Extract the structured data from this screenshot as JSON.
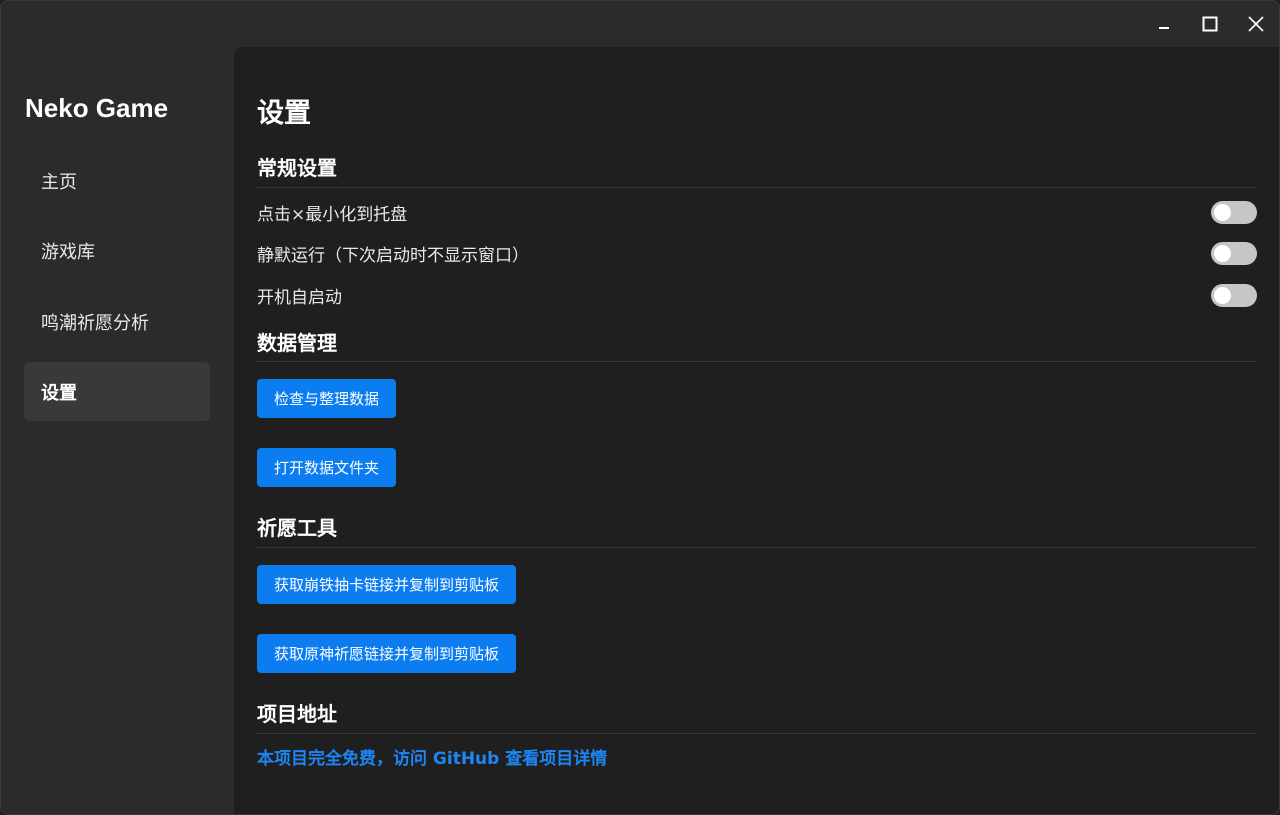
{
  "window": {
    "controls": {
      "minimize_icon": "minimize-icon",
      "maximize_icon": "maximize-icon",
      "close_icon": "close-icon"
    }
  },
  "sidebar": {
    "app_title": "Neko Game",
    "items": [
      {
        "label": "主页",
        "active": false
      },
      {
        "label": "游戏库",
        "active": false
      },
      {
        "label": "鸣潮祈愿分析",
        "active": false
      },
      {
        "label": "设置",
        "active": true
      }
    ]
  },
  "main": {
    "page_title": "设置",
    "general": {
      "title": "常规设置",
      "settings": [
        {
          "label": "点击×最小化到托盘",
          "enabled": false
        },
        {
          "label": "静默运行（下次启动时不显示窗口）",
          "enabled": false
        },
        {
          "label": "开机自启动",
          "enabled": false
        }
      ]
    },
    "data_management": {
      "title": "数据管理",
      "buttons": [
        "检查与整理数据",
        "打开数据文件夹"
      ]
    },
    "wish_tools": {
      "title": "祈愿工具",
      "buttons": [
        "获取崩铁抽卡链接并复制到剪贴板",
        "获取原神祈愿链接并复制到剪贴板"
      ]
    },
    "project": {
      "title": "项目地址",
      "link_text": "本项目完全免费，访问 GitHub 查看项目详情"
    }
  },
  "colors": {
    "accent": "#0c7cf1",
    "link": "#1d86f5",
    "sidebar_bg": "#2b2b2b",
    "main_bg": "#1f1f1f",
    "toggle_off": "#c6c6c6"
  }
}
